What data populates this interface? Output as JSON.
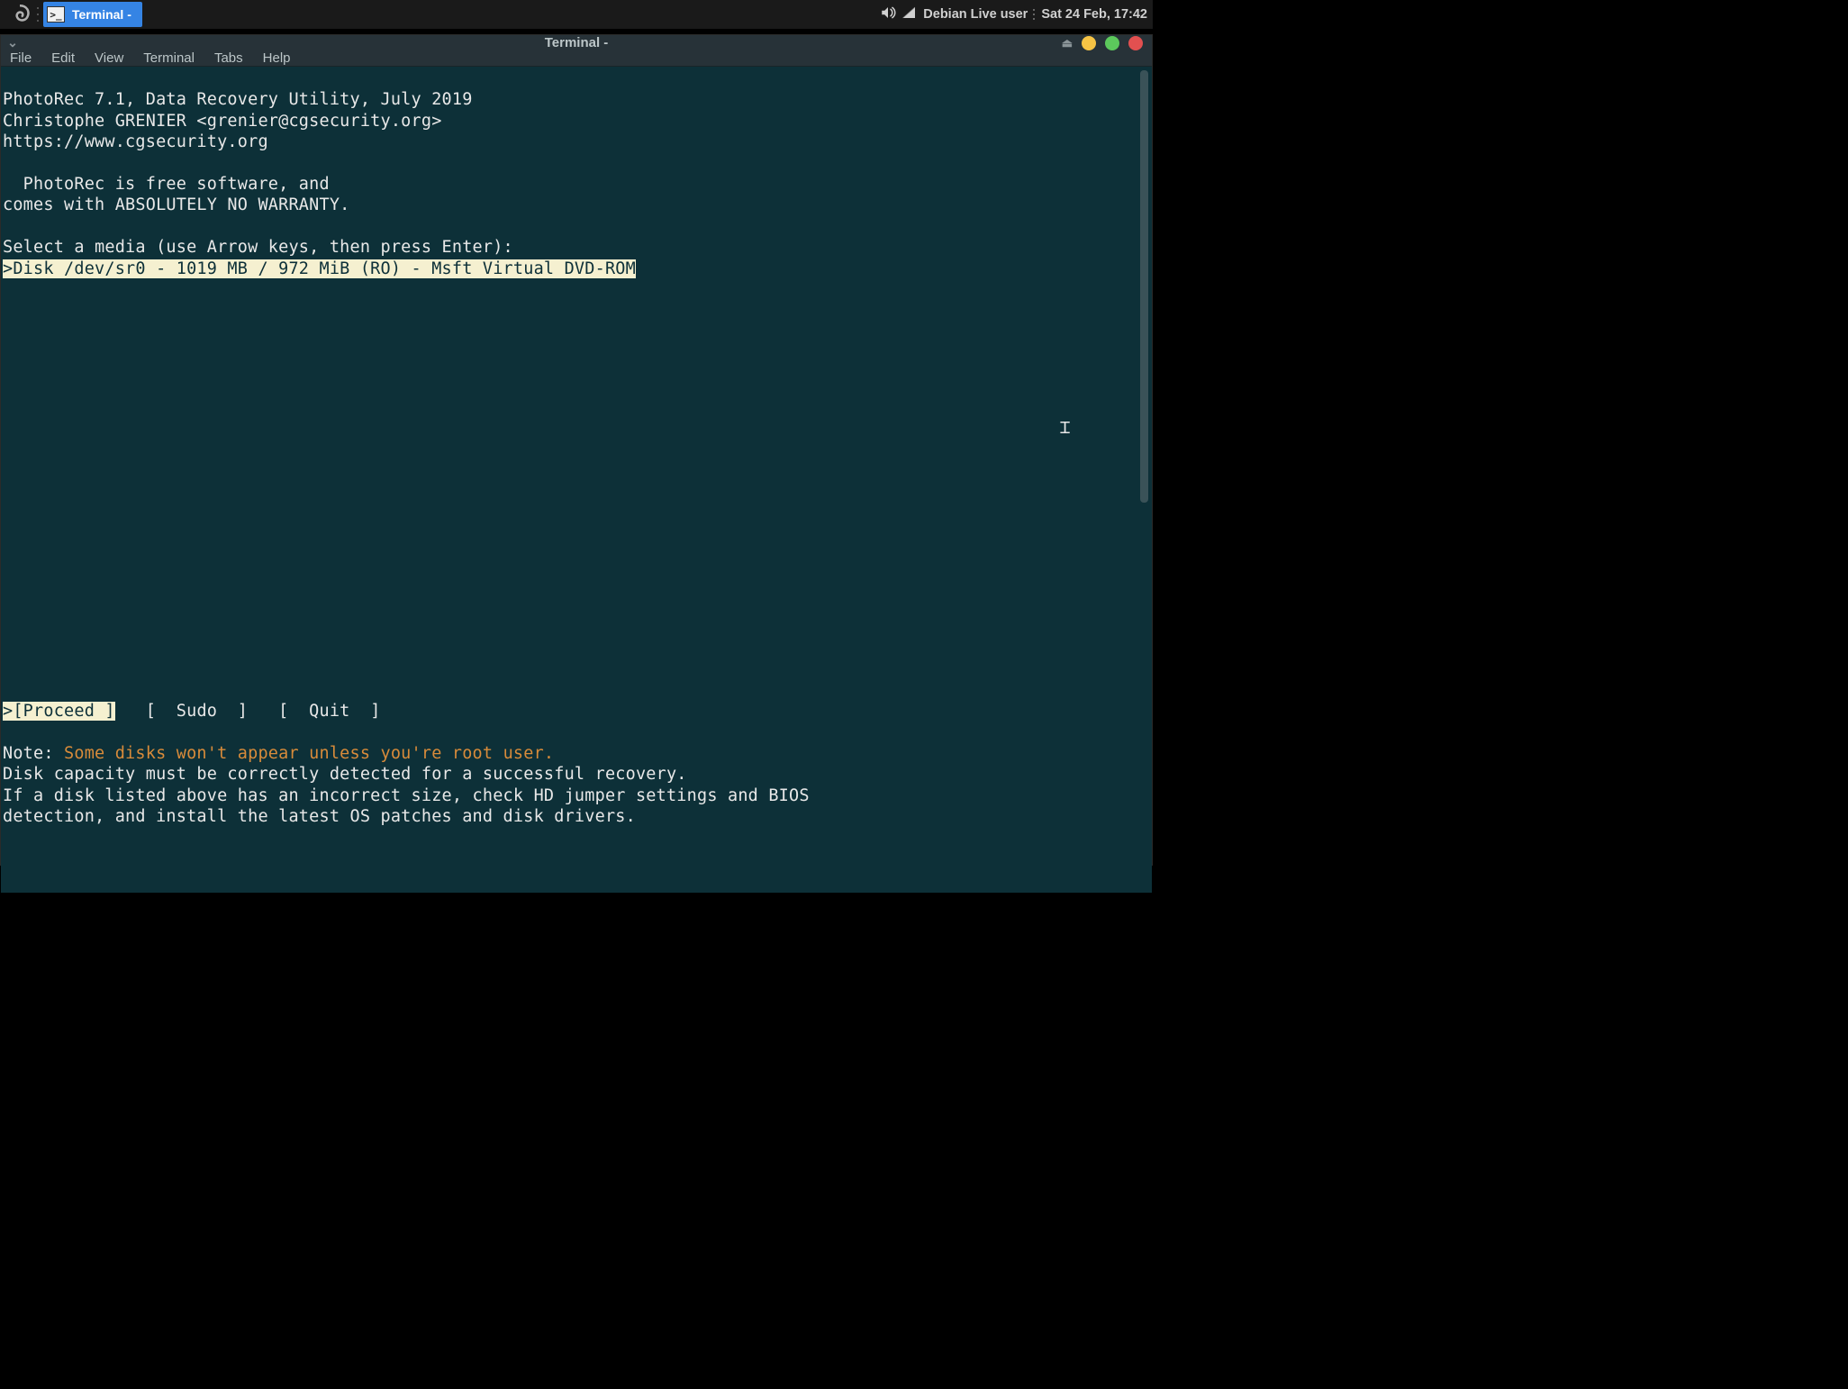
{
  "panel": {
    "taskbar_label": "Terminal -",
    "user": "Debian Live user",
    "datetime": "Sat 24 Feb, 17:42"
  },
  "window": {
    "title": "Terminal -"
  },
  "menubar": {
    "file": "File",
    "edit": "Edit",
    "view": "View",
    "terminal": "Terminal",
    "tabs": "Tabs",
    "help": "Help"
  },
  "terminal": {
    "l1": "PhotoRec 7.1, Data Recovery Utility, July 2019",
    "l2": "Christophe GRENIER <grenier@cgsecurity.org>",
    "l3": "https://www.cgsecurity.org",
    "l4": "",
    "l5": "  PhotoRec is free software, and",
    "l6": "comes with ABSOLUTELY NO WARRANTY.",
    "l7": "",
    "l8": "Select a media (use Arrow keys, then press Enter):",
    "l9": ">Disk /dev/sr0 - 1019 MB / 972 MiB (RO) - Msft Virtual DVD-ROM",
    "options_prefix": ">",
    "opt_proceed": "[Proceed ]",
    "opt_sudo": "[  Sudo  ]",
    "opt_quit": "[  Quit  ]",
    "note_label": "Note: ",
    "note_warn": "Some disks won't appear unless you're root user.",
    "n2": "Disk capacity must be correctly detected for a successful recovery.",
    "n3": "If a disk listed above has an incorrect size, check HD jumper settings and BIOS",
    "n4": "detection, and install the latest OS patches and disk drivers."
  }
}
